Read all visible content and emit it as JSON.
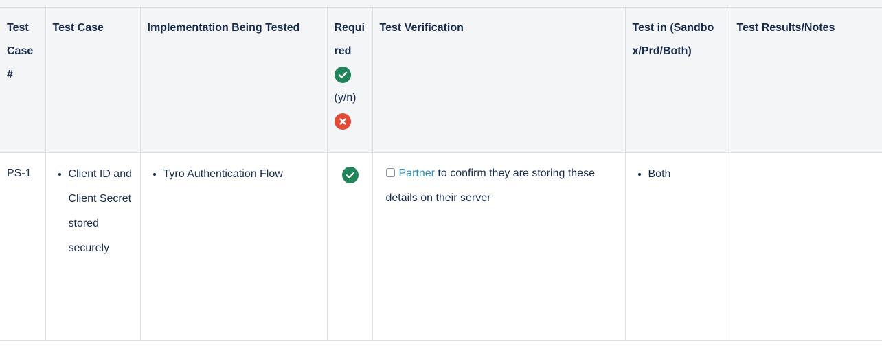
{
  "headers": {
    "case_no": "Test Case #",
    "test_case": "Test Case",
    "implementation": "Implementation Being Tested",
    "required_label": "Required",
    "required_yn": "(y/n)",
    "verification": "Test Verification",
    "test_in": "Test in (Sandbox/Prd/Both)",
    "results": "Test Results/Notes"
  },
  "rows": [
    {
      "case_no": "PS-1",
      "test_case": "Client ID and Client Secret stored securely",
      "implementation": "Tyro Authentication Flow",
      "required": "yes",
      "verification_link": "Partner",
      "verification_text": " to confirm they are storing these details on their server",
      "test_in": "Both",
      "results": ""
    }
  ],
  "colors": {
    "header_bg": "#f4f5f7",
    "border": "#dfe1e6",
    "text": "#172b4d",
    "link": "#2a8fbd",
    "success": "#1f845a",
    "error": "#e34935"
  },
  "icons": {
    "yes": "check-circle-icon",
    "no": "cross-circle-icon",
    "task": "checkbox-icon"
  }
}
